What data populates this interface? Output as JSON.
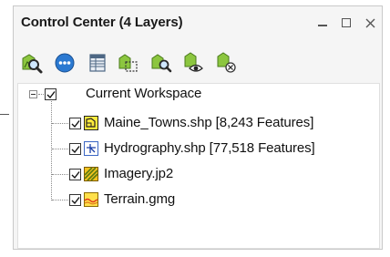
{
  "panel": {
    "title": "Control Center (4 Layers)",
    "window_buttons": [
      "minimize",
      "maximize",
      "close"
    ]
  },
  "toolbar": {
    "tools": [
      {
        "name": "zoom-to-layer-icon"
      },
      {
        "name": "layer-options-icon"
      },
      {
        "name": "attribute-table-icon"
      },
      {
        "name": "layer-extent-icon"
      },
      {
        "name": "zoom-layer-icon"
      },
      {
        "name": "show-layer-icon"
      },
      {
        "name": "remove-layer-icon"
      }
    ]
  },
  "tree": {
    "root": {
      "label": "Current Workspace",
      "checked": true,
      "expanded": true
    },
    "layers": [
      {
        "label": "Maine_Towns.shp [8,243 Features]",
        "checked": true,
        "icon": "polygon-layer-icon"
      },
      {
        "label": "Hydrography.shp [77,518 Features]",
        "checked": true,
        "icon": "line-layer-icon"
      },
      {
        "label": "Imagery.jp2",
        "checked": true,
        "icon": "raster-layer-icon"
      },
      {
        "label": "Terrain.gmg",
        "checked": true,
        "icon": "terrain-layer-icon"
      }
    ]
  }
}
